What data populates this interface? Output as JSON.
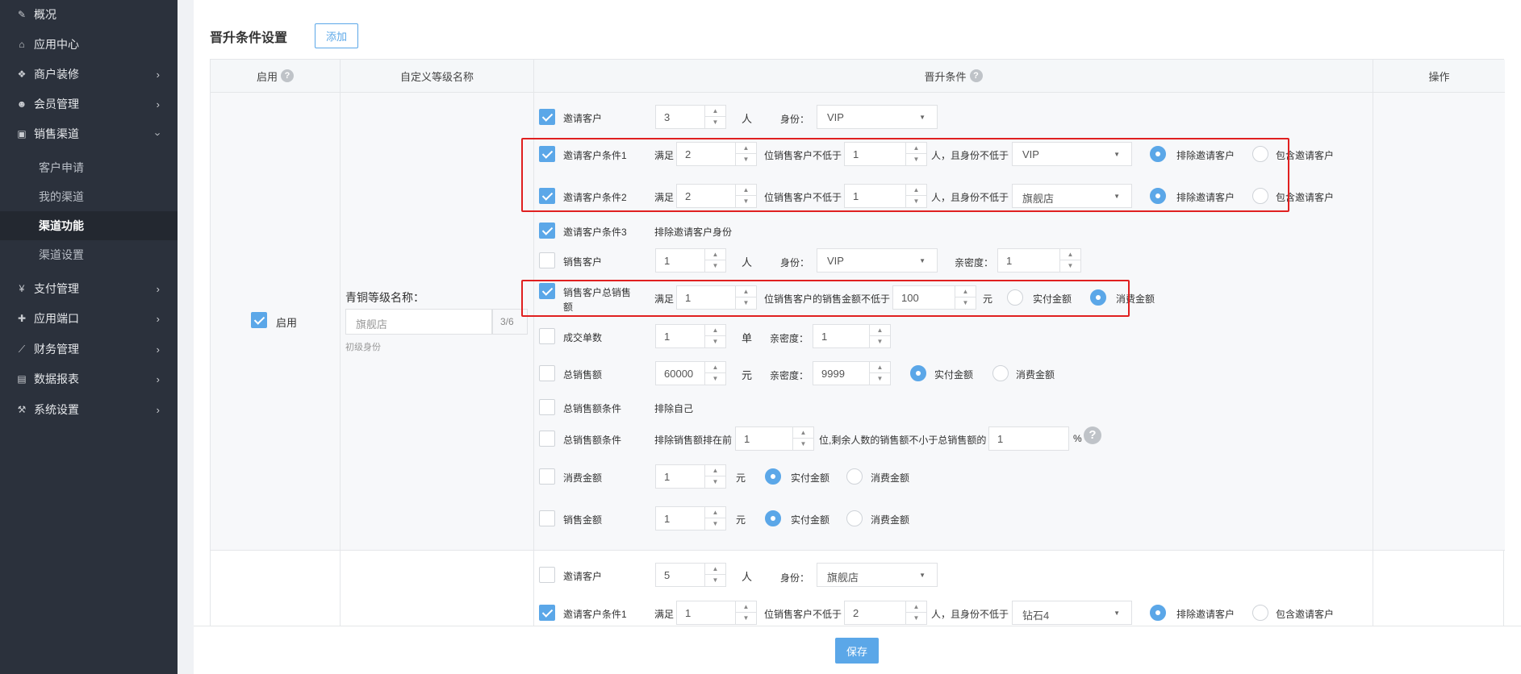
{
  "sidebar": {
    "items": [
      {
        "label": "概况",
        "icon": "edit-icon"
      },
      {
        "label": "应用中心",
        "icon": "home-icon"
      },
      {
        "label": "商户装修",
        "icon": "cubes-icon"
      },
      {
        "label": "会员管理",
        "icon": "users-icon"
      },
      {
        "label": "销售渠道",
        "icon": "money-icon"
      },
      {
        "label": "支付管理",
        "icon": "yen-icon"
      },
      {
        "label": "应用端口",
        "icon": "puzzle-icon"
      },
      {
        "label": "财务管理",
        "icon": "chart-line-icon"
      },
      {
        "label": "数据报表",
        "icon": "report-icon"
      },
      {
        "label": "系统设置",
        "icon": "gavel-icon"
      }
    ],
    "sub_items": [
      "客户申请",
      "我的渠道",
      "渠道功能",
      "渠道设置"
    ]
  },
  "section": {
    "title": "晋升条件设置",
    "add_label": "添加"
  },
  "table": {
    "headers": [
      "启用",
      "自定义等级名称",
      "晋升条件",
      "操作"
    ]
  },
  "row1": {
    "enable_label": "启用",
    "level_label": "青铜等级名称：",
    "level_placeholder": "旗舰店",
    "level_count": "3/6",
    "level_hint": "初级身份",
    "c1": {
      "label": "邀请客户",
      "val": "3",
      "unit": "人",
      "id_label": "身份：",
      "id_val": "VIP"
    },
    "c2": {
      "label": "邀请客户条件1",
      "satisfy": "满足",
      "val1": "2",
      "mid": "位销售客户不低于",
      "val2": "1",
      "post": "人，且身份不低于",
      "sel": "VIP",
      "r1": "排除邀请客户",
      "r2": "包含邀请客户"
    },
    "c3": {
      "label": "邀请客户条件2",
      "satisfy": "满足",
      "val1": "2",
      "mid": "位销售客户不低于",
      "val2": "1",
      "post": "人，且身份不低于",
      "sel": "旗舰店",
      "r1": "排除邀请客户",
      "r2": "包含邀请客户"
    },
    "c4": {
      "label": "邀请客户条件3",
      "desc": "排除邀请客户身份"
    },
    "c5": {
      "label": "销售客户",
      "val": "1",
      "unit": "人",
      "id_label": "身份：",
      "id_val": "VIP",
      "aff_label": "亲密度：",
      "aff_val": "1"
    },
    "c6": {
      "label_l1": "销售客户总销售",
      "label_l2": "额",
      "satisfy": "满足",
      "val1": "1",
      "mid": "位销售客户的销售金额不低于",
      "val2": "100",
      "unit": "元",
      "r1": "实付金额",
      "r2": "消费金额"
    },
    "c7": {
      "label": "成交单数",
      "val": "1",
      "unit": "单",
      "aff_label": "亲密度：",
      "aff_val": "1"
    },
    "c8": {
      "label": "总销售额",
      "val": "60000",
      "unit": "元",
      "aff_label": "亲密度：",
      "aff_val": "9999",
      "r1": "实付金额",
      "r2": "消费金额"
    },
    "c9": {
      "label": "总销售额条件",
      "desc": "排除自己"
    },
    "c10": {
      "label": "总销售额条件",
      "pre": "排除销售额排在前",
      "val1": "1",
      "mid": "位,剩余人数的销售额不小于总销售额的",
      "val2": "1",
      "unit": "%"
    },
    "c11": {
      "label": "消费金额",
      "val": "1",
      "unit": "元",
      "r1": "实付金额",
      "r2": "消费金额"
    },
    "c12": {
      "label": "销售金额",
      "val": "1",
      "unit": "元",
      "r1": "实付金额",
      "r2": "消费金额"
    }
  },
  "row2": {
    "c1": {
      "label": "邀请客户",
      "val": "5",
      "unit": "人",
      "id_label": "身份：",
      "id_val": "旗舰店"
    },
    "c2": {
      "label": "邀请客户条件1",
      "satisfy": "满足",
      "val1": "1",
      "mid": "位销售客户不低于",
      "val2": "2",
      "post": "人，且身份不低于",
      "sel": "钻石4",
      "r1": "排除邀请客户",
      "r2": "包含邀请客户"
    }
  },
  "footer": {
    "save_label": "保存"
  },
  "colors": {
    "accent": "#5ba7e8",
    "sidebar": "#2b313c",
    "highlight": "#e02020"
  }
}
